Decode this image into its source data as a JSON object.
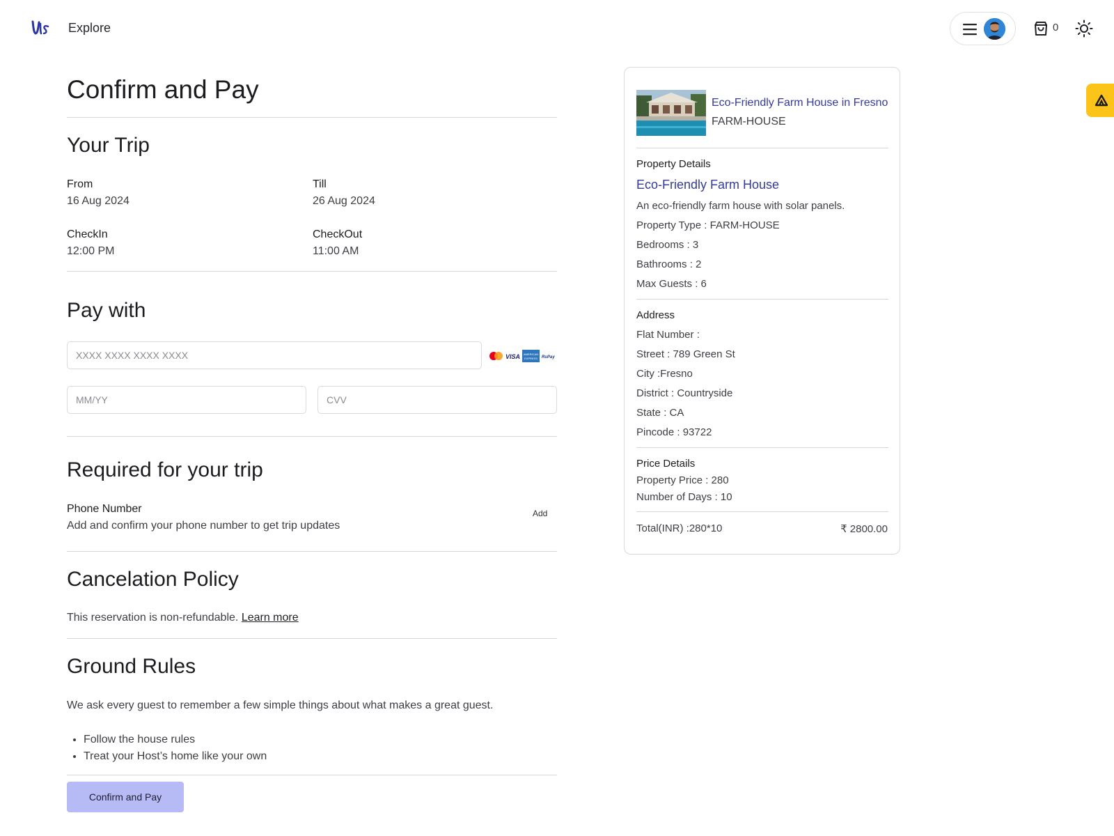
{
  "nav": {
    "explore": "Explore",
    "cart_count": "0"
  },
  "page": {
    "title": "Confirm and Pay"
  },
  "trip": {
    "heading": "Your Trip",
    "from_label": "From",
    "from_value": "16 Aug 2024",
    "till_label": "Till",
    "till_value": "26 Aug 2024",
    "checkin_label": "CheckIn",
    "checkin_value": "12:00 PM",
    "checkout_label": "CheckOut",
    "checkout_value": "11:00 AM"
  },
  "payment": {
    "heading": "Pay with",
    "card_placeholder": "XXXX XXXX XXXX XXXX",
    "expiry_placeholder": "MM/YY",
    "cvv_placeholder": "CVV",
    "card_brands": [
      "MasterCard",
      "VISA",
      "AMERICAN EXPRESS",
      "RuPay"
    ]
  },
  "required": {
    "heading": "Required for your trip",
    "phone_label": "Phone Number",
    "phone_desc": "Add and confirm your phone number to get trip updates",
    "add_label": "Add"
  },
  "cancellation": {
    "heading": "Cancelation Policy",
    "text": "This reservation is non-refundable.",
    "link": "Learn more"
  },
  "ground_rules": {
    "heading": "Ground Rules",
    "intro": "We ask every guest to remember a few simple things about what makes a great guest.",
    "items": [
      "Follow the house rules",
      "Treat your Host’s home like your own"
    ]
  },
  "confirm_button": "Confirm and Pay",
  "summary": {
    "title": "Eco-Friendly Farm House in Fresno",
    "type": "FARM-HOUSE",
    "property_heading": "Property Details",
    "property_name": "Eco-Friendly Farm House",
    "description": "An eco-friendly farm house with solar panels.",
    "property_type": "Property Type : FARM-HOUSE",
    "bedrooms": "Bedrooms : 3",
    "bathrooms": "Bathrooms : 2",
    "max_guests": "Max Guests : 6",
    "address_heading": "Address",
    "flat": "Flat Number :",
    "street": "Street : 789 Green St",
    "city": "City :Fresno",
    "district": "District : Countryside",
    "state": "State : CA",
    "pincode": "Pincode : 93722",
    "price_heading": "Price Details",
    "property_price": "Property Price : 280",
    "days": "Number of Days : 10",
    "total_label": "Total(INR) :280*10",
    "total_value": "₹ 2800.00"
  },
  "colors": {
    "accent": "#343aa0",
    "button": "#b7bbf5",
    "side_tab": "#fcc419"
  }
}
